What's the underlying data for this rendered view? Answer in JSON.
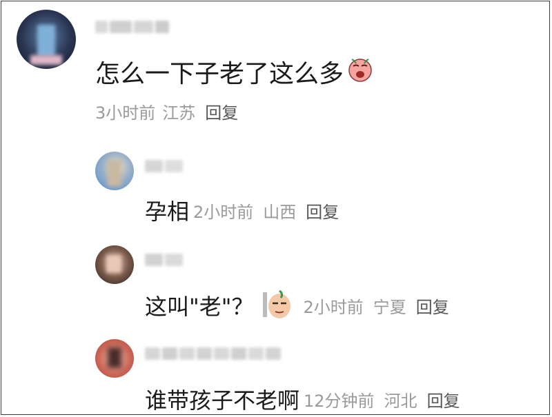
{
  "comments": [
    {
      "text": "怎么一下子老了这么多",
      "emoji": "crying-face-emoji",
      "time": "3小时前",
      "location": "江苏",
      "reply": "回复"
    }
  ],
  "replies": [
    {
      "text": "孕相",
      "time": "2小时前",
      "location": "山西",
      "reply": "回复"
    },
    {
      "text": "这叫\"老\"？",
      "emoji": "skeptical-face-emoji",
      "time": "2小时前",
      "location": "宁夏",
      "reply": "回复"
    },
    {
      "text": "谁带孩子不老啊",
      "time": "12分钟前",
      "location": "河北",
      "reply": "回复"
    }
  ]
}
